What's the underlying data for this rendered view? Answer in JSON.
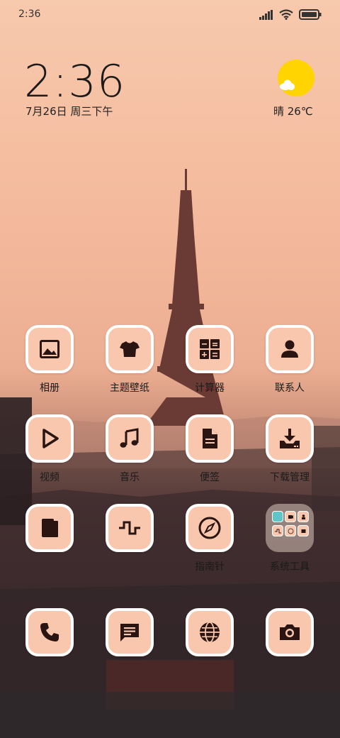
{
  "status_bar": {
    "time": "2:36"
  },
  "clock": {
    "time": "2:36",
    "date": "7月26日 周三下午"
  },
  "weather": {
    "text": "晴 26℃"
  },
  "apps_row1": [
    {
      "label": "相册",
      "icon": "gallery-icon"
    },
    {
      "label": "主题壁纸",
      "icon": "tshirt-icon"
    },
    {
      "label": "计算器",
      "icon": "calculator-icon"
    },
    {
      "label": "联系人",
      "icon": "person-icon"
    }
  ],
  "apps_row2": [
    {
      "label": "视频",
      "icon": "play-icon"
    },
    {
      "label": "音乐",
      "icon": "music-icon"
    },
    {
      "label": "便签",
      "icon": "note-icon"
    },
    {
      "label": "下载管理",
      "icon": "download-icon"
    }
  ],
  "apps_row3": [
    {
      "label": "",
      "icon": "book-icon"
    },
    {
      "label": "",
      "icon": "pulse-icon"
    },
    {
      "label": "指南针",
      "icon": "compass-icon"
    },
    {
      "label": "系统工具",
      "icon": "folder-icon"
    }
  ],
  "dock": [
    {
      "icon": "phone-icon"
    },
    {
      "icon": "message-icon"
    },
    {
      "icon": "browser-icon"
    },
    {
      "icon": "camera-icon"
    }
  ],
  "colors": {
    "icon_bg": "#f8c7ae",
    "icon_glyph": "#2a1512",
    "border": "#ffffff"
  }
}
